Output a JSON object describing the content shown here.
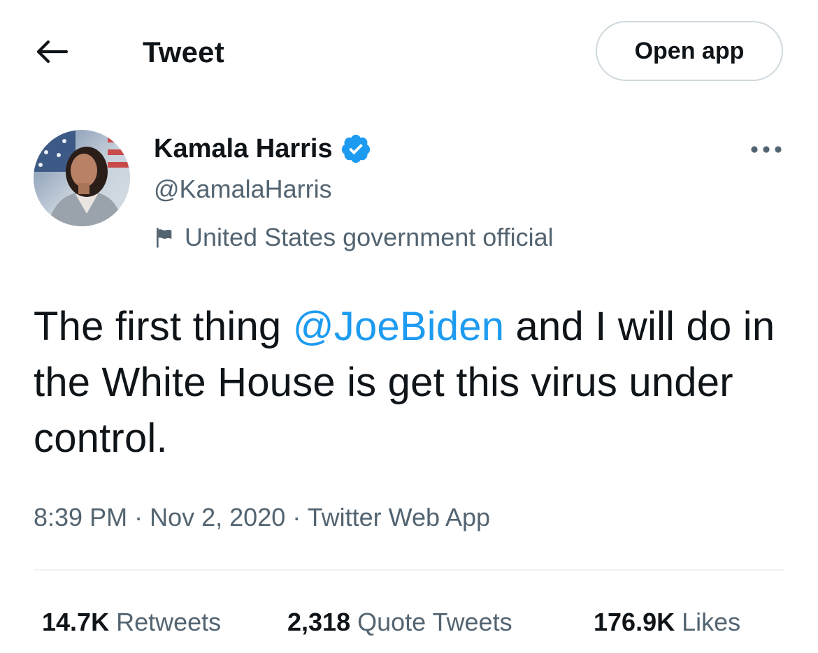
{
  "header": {
    "title": "Tweet",
    "open_app_label": "Open app"
  },
  "author": {
    "name": "Kamala Harris",
    "handle": "@KamalaHarris",
    "label": "United States government official",
    "verified": true
  },
  "tweet": {
    "text_before": "The first thing ",
    "mention": "@JoeBiden",
    "text_after": " and I will do in the White House is get this virus under control."
  },
  "meta": {
    "time": "8:39 PM",
    "separator": "·",
    "date": "Nov 2, 2020",
    "source": "Twitter Web App"
  },
  "stats": {
    "retweets": {
      "count": "14.7K",
      "label": "Retweets"
    },
    "quote_tweets": {
      "count": "2,318",
      "label": "Quote Tweets"
    },
    "likes": {
      "count": "176.9K",
      "label": "Likes"
    }
  },
  "colors": {
    "accent": "#1d9bf0",
    "text": "#0f1419",
    "secondary": "#536471",
    "border": "#cfd9de"
  },
  "icons": {
    "back": "arrow-left-icon",
    "verified": "verified-badge-icon",
    "label": "flag-icon",
    "more": "more-dots-icon"
  }
}
